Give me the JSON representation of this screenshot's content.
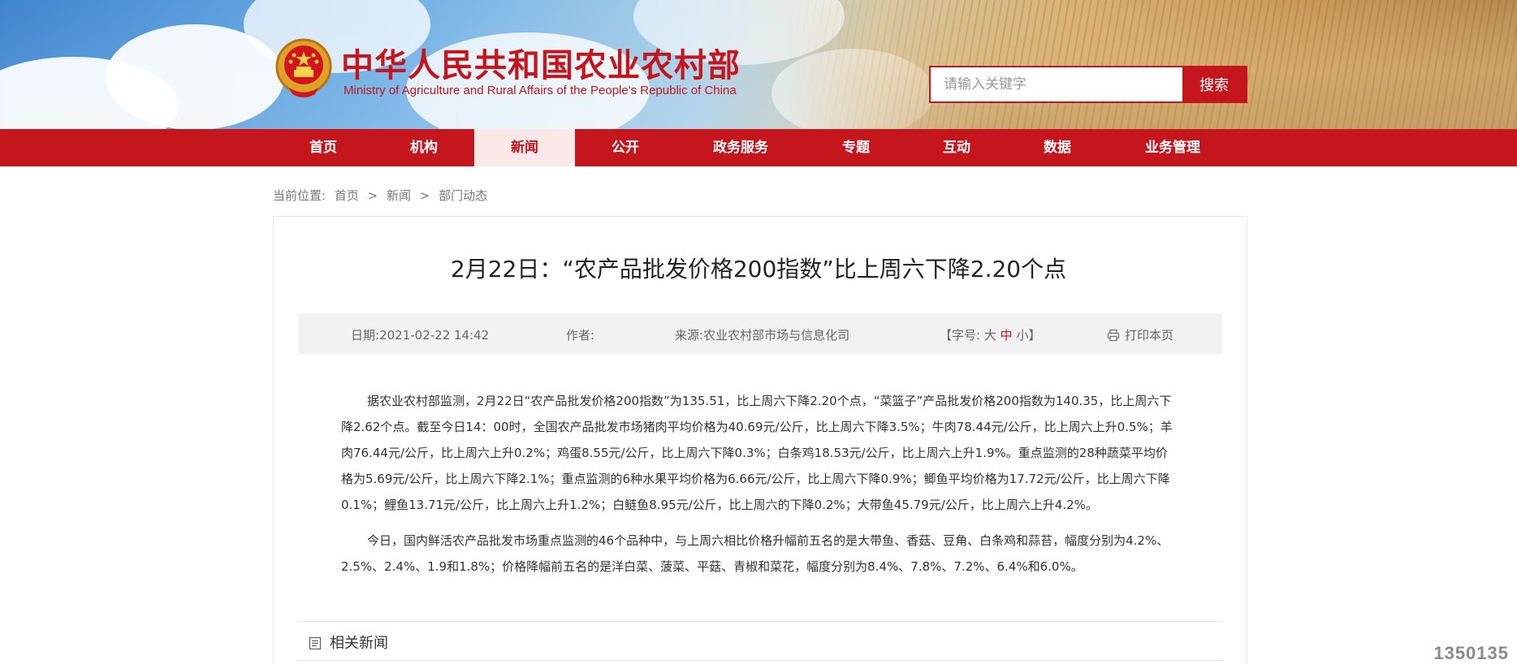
{
  "site": {
    "title_cn": "中华人民共和国农业农村部",
    "title_en": "Ministry of Agriculture and Rural Affairs of the People's Republic of China"
  },
  "search": {
    "placeholder": "请输入关键字",
    "button_label": "搜索"
  },
  "nav": {
    "items": [
      {
        "label": "首页",
        "active": false
      },
      {
        "label": "机构",
        "active": false
      },
      {
        "label": "新闻",
        "active": true
      },
      {
        "label": "公开",
        "active": false
      },
      {
        "label": "政务服务",
        "active": false
      },
      {
        "label": "专题",
        "active": false
      },
      {
        "label": "互动",
        "active": false
      },
      {
        "label": "数据",
        "active": false
      },
      {
        "label": "业务管理",
        "active": false
      }
    ]
  },
  "breadcrumb": {
    "prefix": "当前位置:",
    "items": [
      "首页",
      "新闻",
      "部门动态"
    ],
    "separator": ">"
  },
  "article": {
    "title": "2月22日：“农产品批发价格200指数”比上周六下降2.20个点",
    "meta": {
      "date_label": "日期:",
      "date_value": "2021-02-22 14:42",
      "author_label": "作者:",
      "author_value": "",
      "source_label": "来源:",
      "source_value": "农业农村部市场与信息化司",
      "fontsize_open": "【字号:",
      "fontsize_large": "大",
      "fontsize_medium": "中",
      "fontsize_small": "小",
      "fontsize_close": "】",
      "print_label": "打印本页"
    },
    "paragraphs": [
      "据农业农村部监测，2月22日“农产品批发价格200指数”为135.51，比上周六下降2.20个点，“菜篮子”产品批发价格200指数为140.35，比上周六下降2.62个点。截至今日14：00时，全国农产品批发市场猪肉平均价格为40.69元/公斤，比上周六下降3.5%；牛肉78.44元/公斤，比上周六上升0.5%；羊肉76.44元/公斤，比上周六上升0.2%；鸡蛋8.55元/公斤，比上周六下降0.3%；白条鸡18.53元/公斤，比上周六上升1.9%。重点监测的28种蔬菜平均价格为5.69元/公斤，比上周六下降2.1%；重点监测的6种水果平均价格为6.66元/公斤，比上周六下降0.9%；鲫鱼平均价格为17.72元/公斤，比上周六下降0.1%；鲤鱼13.71元/公斤，比上周六上升1.2%；白鲢鱼8.95元/公斤，比上周六的下降0.2%；大带鱼45.79元/公斤，比上周六上升4.2%。",
      "今日，国内鲜活农产品批发市场重点监测的46个品种中，与上周六相比价格升幅前五名的是大带鱼、香菇、豆角、白条鸡和蒜苔，幅度分别为4.2%、2.5%、2.4%、1.9和1.8%；价格降幅前五名的是洋白菜、菠菜、平菇、青椒和菜花，幅度分别为8.4%、7.8%、7.2%、6.4%和6.0%。"
    ]
  },
  "related": {
    "title": "相关新闻"
  },
  "watermark": "1350135",
  "icons": {
    "emblem": "national-emblem-icon",
    "print": "printer-icon",
    "related": "document-list-icon"
  },
  "colors": {
    "brand_red": "#c4161c",
    "nav_active_bg": "#fbe9e9",
    "meta_bg": "#f2f2f2"
  }
}
